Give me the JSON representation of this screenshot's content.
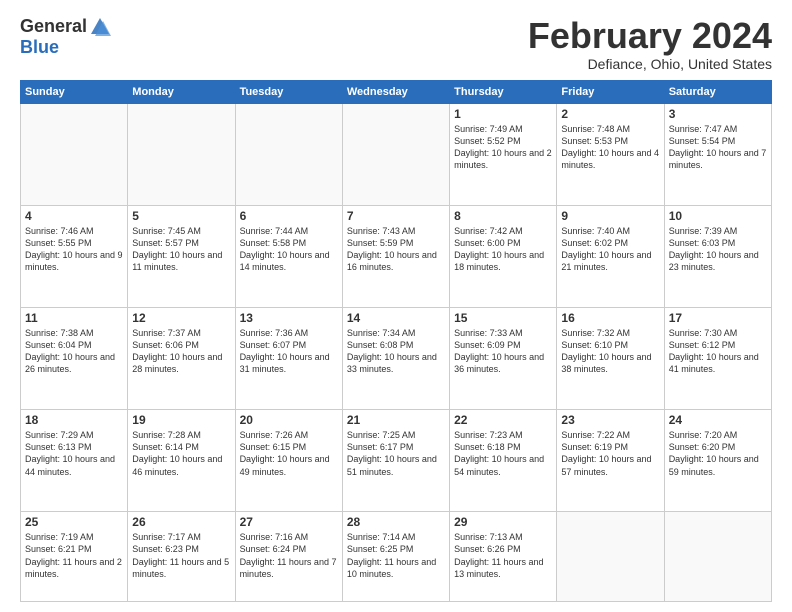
{
  "logo": {
    "general": "General",
    "blue": "Blue"
  },
  "title": "February 2024",
  "location": "Defiance, Ohio, United States",
  "days_of_week": [
    "Sunday",
    "Monday",
    "Tuesday",
    "Wednesday",
    "Thursday",
    "Friday",
    "Saturday"
  ],
  "weeks": [
    [
      {
        "day": "",
        "info": ""
      },
      {
        "day": "",
        "info": ""
      },
      {
        "day": "",
        "info": ""
      },
      {
        "day": "",
        "info": ""
      },
      {
        "day": "1",
        "info": "Sunrise: 7:49 AM\nSunset: 5:52 PM\nDaylight: 10 hours\nand 2 minutes."
      },
      {
        "day": "2",
        "info": "Sunrise: 7:48 AM\nSunset: 5:53 PM\nDaylight: 10 hours\nand 4 minutes."
      },
      {
        "day": "3",
        "info": "Sunrise: 7:47 AM\nSunset: 5:54 PM\nDaylight: 10 hours\nand 7 minutes."
      }
    ],
    [
      {
        "day": "4",
        "info": "Sunrise: 7:46 AM\nSunset: 5:55 PM\nDaylight: 10 hours\nand 9 minutes."
      },
      {
        "day": "5",
        "info": "Sunrise: 7:45 AM\nSunset: 5:57 PM\nDaylight: 10 hours\nand 11 minutes."
      },
      {
        "day": "6",
        "info": "Sunrise: 7:44 AM\nSunset: 5:58 PM\nDaylight: 10 hours\nand 14 minutes."
      },
      {
        "day": "7",
        "info": "Sunrise: 7:43 AM\nSunset: 5:59 PM\nDaylight: 10 hours\nand 16 minutes."
      },
      {
        "day": "8",
        "info": "Sunrise: 7:42 AM\nSunset: 6:00 PM\nDaylight: 10 hours\nand 18 minutes."
      },
      {
        "day": "9",
        "info": "Sunrise: 7:40 AM\nSunset: 6:02 PM\nDaylight: 10 hours\nand 21 minutes."
      },
      {
        "day": "10",
        "info": "Sunrise: 7:39 AM\nSunset: 6:03 PM\nDaylight: 10 hours\nand 23 minutes."
      }
    ],
    [
      {
        "day": "11",
        "info": "Sunrise: 7:38 AM\nSunset: 6:04 PM\nDaylight: 10 hours\nand 26 minutes."
      },
      {
        "day": "12",
        "info": "Sunrise: 7:37 AM\nSunset: 6:06 PM\nDaylight: 10 hours\nand 28 minutes."
      },
      {
        "day": "13",
        "info": "Sunrise: 7:36 AM\nSunset: 6:07 PM\nDaylight: 10 hours\nand 31 minutes."
      },
      {
        "day": "14",
        "info": "Sunrise: 7:34 AM\nSunset: 6:08 PM\nDaylight: 10 hours\nand 33 minutes."
      },
      {
        "day": "15",
        "info": "Sunrise: 7:33 AM\nSunset: 6:09 PM\nDaylight: 10 hours\nand 36 minutes."
      },
      {
        "day": "16",
        "info": "Sunrise: 7:32 AM\nSunset: 6:10 PM\nDaylight: 10 hours\nand 38 minutes."
      },
      {
        "day": "17",
        "info": "Sunrise: 7:30 AM\nSunset: 6:12 PM\nDaylight: 10 hours\nand 41 minutes."
      }
    ],
    [
      {
        "day": "18",
        "info": "Sunrise: 7:29 AM\nSunset: 6:13 PM\nDaylight: 10 hours\nand 44 minutes."
      },
      {
        "day": "19",
        "info": "Sunrise: 7:28 AM\nSunset: 6:14 PM\nDaylight: 10 hours\nand 46 minutes."
      },
      {
        "day": "20",
        "info": "Sunrise: 7:26 AM\nSunset: 6:15 PM\nDaylight: 10 hours\nand 49 minutes."
      },
      {
        "day": "21",
        "info": "Sunrise: 7:25 AM\nSunset: 6:17 PM\nDaylight: 10 hours\nand 51 minutes."
      },
      {
        "day": "22",
        "info": "Sunrise: 7:23 AM\nSunset: 6:18 PM\nDaylight: 10 hours\nand 54 minutes."
      },
      {
        "day": "23",
        "info": "Sunrise: 7:22 AM\nSunset: 6:19 PM\nDaylight: 10 hours\nand 57 minutes."
      },
      {
        "day": "24",
        "info": "Sunrise: 7:20 AM\nSunset: 6:20 PM\nDaylight: 10 hours\nand 59 minutes."
      }
    ],
    [
      {
        "day": "25",
        "info": "Sunrise: 7:19 AM\nSunset: 6:21 PM\nDaylight: 11 hours\nand 2 minutes."
      },
      {
        "day": "26",
        "info": "Sunrise: 7:17 AM\nSunset: 6:23 PM\nDaylight: 11 hours\nand 5 minutes."
      },
      {
        "day": "27",
        "info": "Sunrise: 7:16 AM\nSunset: 6:24 PM\nDaylight: 11 hours\nand 7 minutes."
      },
      {
        "day": "28",
        "info": "Sunrise: 7:14 AM\nSunset: 6:25 PM\nDaylight: 11 hours\nand 10 minutes."
      },
      {
        "day": "29",
        "info": "Sunrise: 7:13 AM\nSunset: 6:26 PM\nDaylight: 11 hours\nand 13 minutes."
      },
      {
        "day": "",
        "info": ""
      },
      {
        "day": "",
        "info": ""
      }
    ]
  ]
}
